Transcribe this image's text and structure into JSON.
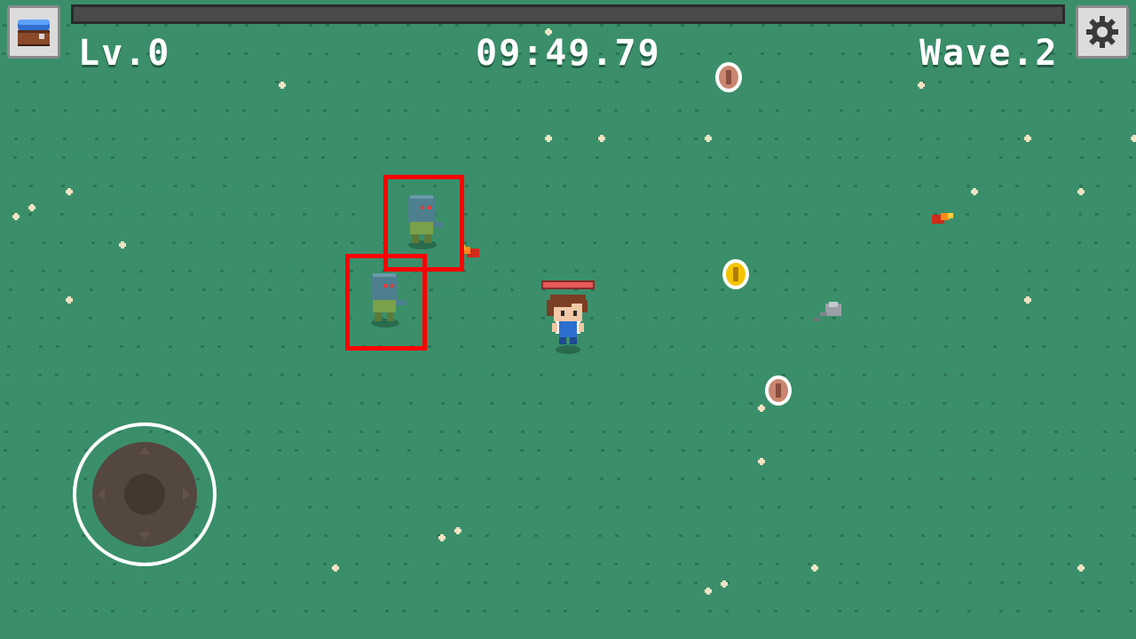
{
  "hud": {
    "level": "Lv.0",
    "timer": "09:49.79",
    "wave": "Wave.2",
    "xp_progress": 0
  },
  "buttons": {
    "chest_icon": "treasure-chest-icon",
    "settings_icon": "gear-icon"
  },
  "colors": {
    "ground": "#3a8f6a",
    "highlight_box": "#ff0000",
    "player_health": "#e85a5a",
    "gold_coin": "#f5c400",
    "copper_coin": "#c98670"
  },
  "entities": {
    "player": "player-character",
    "enemies": [
      "zombie-enemy",
      "zombie-enemy"
    ],
    "pickups": [
      "copper-coin",
      "gold-coin",
      "copper-coin"
    ],
    "projectiles": [
      "fireball",
      "fireball"
    ],
    "props": [
      "rock"
    ]
  }
}
